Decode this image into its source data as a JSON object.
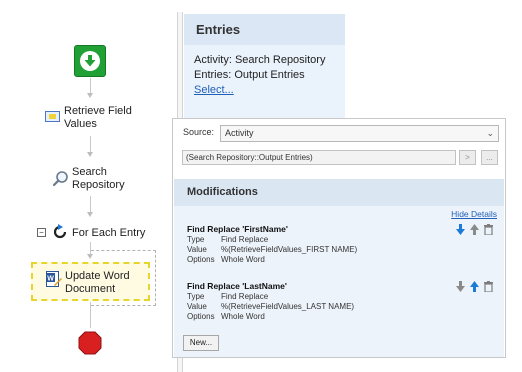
{
  "workflow": {
    "nodes": [
      {
        "label": "Retrieve Field Values"
      },
      {
        "label": "Search Repository"
      },
      {
        "label": "For Each Entry"
      },
      {
        "label": "Update Word Document"
      }
    ],
    "collapse_glyph": "−"
  },
  "entries": {
    "title": "Entries",
    "activity_label": "Activity:",
    "activity_value": "Search Repository",
    "entries_label": "Entries:",
    "entries_value": "Output Entries",
    "select_link": "Select..."
  },
  "properties": {
    "source_label": "Source:",
    "source_value": "Activity",
    "expression_value": "(Search Repository::Output Entries)",
    "arrow_button": ">",
    "browse_button": "...",
    "modifications": {
      "title": "Modifications",
      "hide_details": "Hide Details",
      "items": [
        {
          "title": "Find Replace 'FirstName'",
          "type_label": "Type",
          "type_value": "Find Replace",
          "value_label": "Value",
          "value_value": "%(RetrieveFieldValues_FIRST NAME)",
          "options_label": "Options",
          "options_value": "Whole Word"
        },
        {
          "title": "Find Replace 'LastName'",
          "type_label": "Type",
          "type_value": "Find Replace",
          "value_label": "Value",
          "value_value": "%(RetrieveFieldValues_LAST NAME)",
          "options_label": "Options",
          "options_value": "Whole Word"
        }
      ],
      "new_button": "New..."
    }
  },
  "colors": {
    "start_green": "#21a035",
    "stop_red": "#d92020",
    "selection_yellow": "#e6d52a",
    "link_blue": "#1f5fb8",
    "arrow_blue": "#1c7bd6",
    "arrow_gray": "#8a8a8a"
  }
}
